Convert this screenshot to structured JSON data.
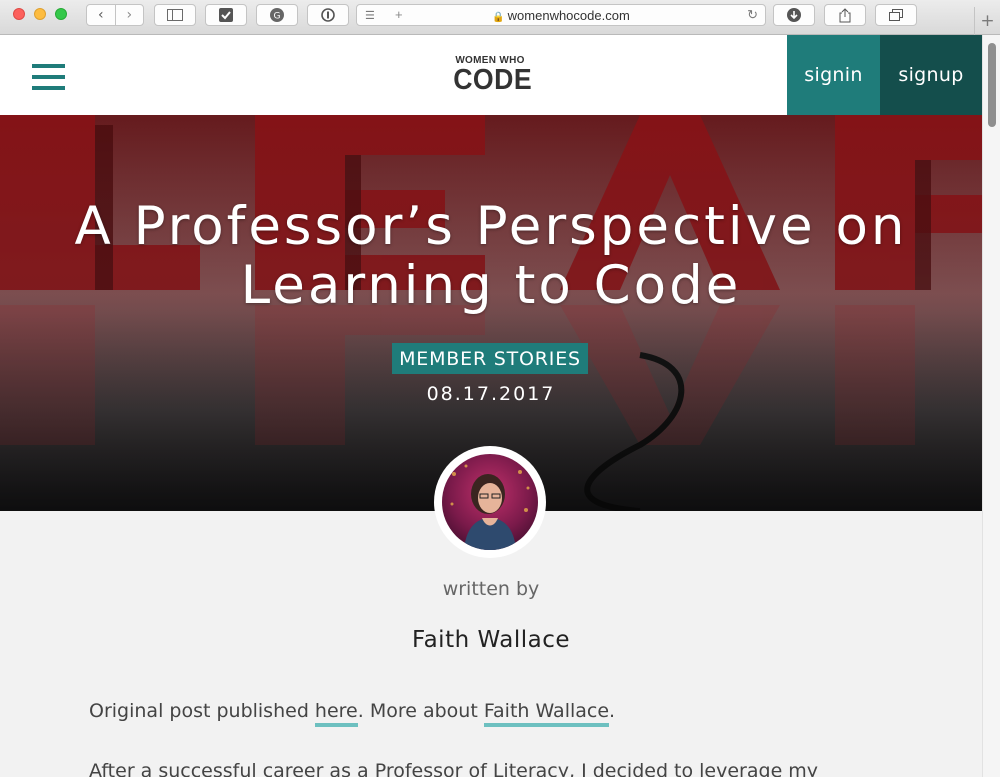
{
  "browser": {
    "url": "womenwhocode.com",
    "tab_plus": "+",
    "newtab_plus": "+"
  },
  "header": {
    "logo_small": "WOMEN WHO",
    "logo_big": "CODE",
    "signin": "signin",
    "signup": "signup"
  },
  "hero": {
    "title_line1": "A Professor’s Perspective on",
    "title_line2": "Learning to Code",
    "category": "MEMBER STORIES",
    "date": "08.17.2017"
  },
  "byline": {
    "written_by": "written by",
    "author": "Faith Wallace"
  },
  "article": {
    "p1_before": "Original post published ",
    "p1_link1": "here",
    "p1_middle": ". More about ",
    "p1_link2": "Faith Wallace",
    "p1_after": ".",
    "p2": "After a successful career as a Professor of Literacy, I decided to leverage my"
  },
  "colors": {
    "brand_teal": "#1f7c7a",
    "brand_teal_dark": "#144e4c",
    "link_underline": "#6dc0c0"
  }
}
